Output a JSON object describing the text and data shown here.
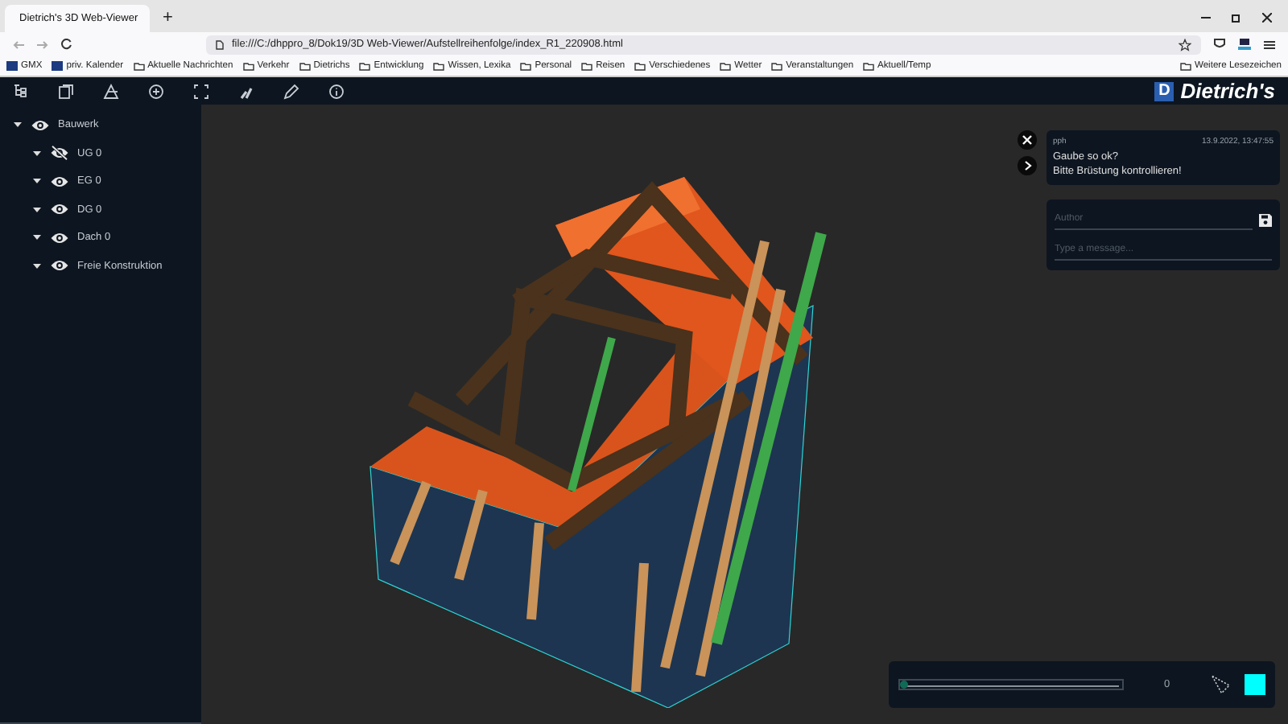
{
  "browser": {
    "tab_title": "Dietrich's 3D Web-Viewer",
    "new_tab": "+",
    "url": "file:///C:/dhppro_8/Dok19/3D Web-Viewer/Aufstellreihenfolge/index_R1_220908.html",
    "bookmarks": [
      {
        "label": "GMX",
        "kind": "site"
      },
      {
        "label": "priv. Kalender",
        "kind": "site"
      },
      {
        "label": "Aktuelle Nachrichten",
        "kind": "folder"
      },
      {
        "label": "Verkehr",
        "kind": "folder"
      },
      {
        "label": "Dietrichs",
        "kind": "folder"
      },
      {
        "label": "Entwicklung",
        "kind": "folder"
      },
      {
        "label": "Wissen, Lexika",
        "kind": "folder"
      },
      {
        "label": "Personal",
        "kind": "folder"
      },
      {
        "label": "Reisen",
        "kind": "folder"
      },
      {
        "label": "Verschiedenes",
        "kind": "folder"
      },
      {
        "label": "Wetter",
        "kind": "folder"
      },
      {
        "label": "Veranstaltungen",
        "kind": "folder"
      },
      {
        "label": "Aktuell/Temp",
        "kind": "folder"
      }
    ],
    "other_bookmarks": "Weitere Lesezeichen"
  },
  "app": {
    "logo_letter": "D",
    "brand": "Dietrich's"
  },
  "tree": [
    {
      "label": "Bauwerk",
      "visible": true,
      "expanded": true,
      "children": [
        {
          "label": "UG 0",
          "visible": false,
          "expanded": true
        },
        {
          "label": "EG 0",
          "visible": true,
          "expanded": true
        },
        {
          "label": "DG 0",
          "visible": true,
          "expanded": true
        },
        {
          "label": "Dach 0",
          "visible": true,
          "expanded": true
        },
        {
          "label": "Freie Konstruktion",
          "visible": true,
          "expanded": true
        }
      ]
    }
  ],
  "comment": {
    "author": "pph",
    "time": "13.9.2022, 13:47:55",
    "lines": [
      "Gaube so ok?",
      "Bitte Brüstung kontrollieren!"
    ]
  },
  "form": {
    "author_placeholder": "Author",
    "message_placeholder": "Type a message..."
  },
  "player": {
    "level": 0,
    "reading": "0",
    "color": "#00ffff"
  }
}
